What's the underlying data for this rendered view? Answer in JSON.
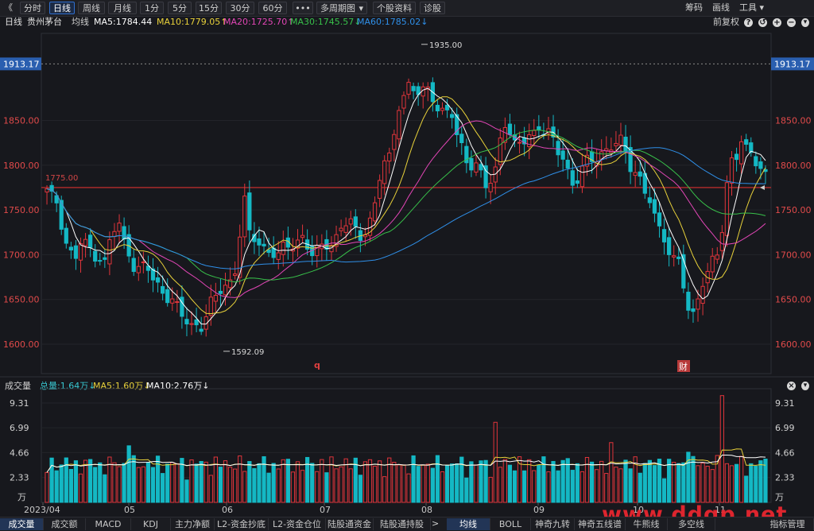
{
  "toolbar": {
    "back_icon": "double-chevron-left-icon",
    "back_glyph": "《",
    "periods": [
      "分时",
      "日线",
      "周线",
      "月线",
      "1分",
      "5分",
      "15分",
      "30分",
      "60分"
    ],
    "active_period": "日线",
    "more_glyph": "•••",
    "multi_period": "多周期图",
    "stock_info": "个股资料",
    "diagnose": "诊股",
    "chips": "筹码",
    "draw": "画线",
    "tools": "工具",
    "icons": [
      "help-icon",
      "add-icon",
      "remove-icon"
    ],
    "icon_glyphs": [
      "?",
      "+",
      "−"
    ]
  },
  "legend": {
    "period": "日线",
    "stock_name": "贵州茅台",
    "mean_line": "均线",
    "ma5": "MA5:1784.44",
    "ma10": "MA10:1779.05↑",
    "ma20": "MA20:1725.70↑",
    "ma30": "MA30:1745.57↓",
    "ma60": "MA60:1785.02↓",
    "adjust": "前复权",
    "colors": {
      "ma5": "#ffffff",
      "ma10": "#e8d13a",
      "ma20": "#e246b6",
      "ma30": "#38c04a",
      "ma60": "#2f8fe8"
    }
  },
  "volume_legend": {
    "label": "成交量",
    "total": "总量:1.64万↓",
    "ma5": "MA5:1.60万↓",
    "ma10": "MA10:2.76万↓"
  },
  "price_axis": {
    "ticks": [
      "1850.00",
      "1800.00",
      "1750.00",
      "1700.00",
      "1650.00",
      "1600.00"
    ],
    "current": "1913.17"
  },
  "volume_axis": {
    "ticks": [
      "9.31",
      "6.99",
      "4.66",
      "2.33"
    ],
    "unit": "万"
  },
  "annotations": {
    "high": "1935.00",
    "low": "1592.09",
    "hline": "1775.00",
    "marker_q": "q",
    "marker_cai": "财"
  },
  "chart_data": {
    "type": "candlestick",
    "title": "贵州茅台 日线",
    "x": [
      "2023/04",
      "05",
      "06",
      "07",
      "08",
      "09",
      "10",
      "11"
    ],
    "ylim": [
      1580,
      1950
    ],
    "yticks": [
      1600,
      1650,
      1700,
      1750,
      1800,
      1850
    ],
    "volume_ticks": [
      2.33,
      4.66,
      6.99,
      9.31
    ],
    "volume_unit": "万",
    "series": [
      {
        "name": "MA5",
        "last": 1784.44
      },
      {
        "name": "MA10",
        "last": 1779.05
      },
      {
        "name": "MA20",
        "last": 1725.7
      },
      {
        "name": "MA30",
        "last": 1745.57
      },
      {
        "name": "MA60",
        "last": 1785.02
      }
    ],
    "high": 1935.0,
    "low": 1592.09,
    "hline": 1775.0,
    "current": 1913.17
  },
  "bottom_tabs": [
    "成交量",
    "成交额",
    "MACD",
    "KDJ",
    "主力净额",
    "L2-资金抄底",
    "L2-资金仓位",
    "陆股通资金",
    "陆股通持股"
  ],
  "bottom_tabs_right": [
    "均线",
    "BOLL",
    "神奇九转",
    "神奇五线谱",
    "牛熊线",
    "多空线",
    "指标管理"
  ],
  "watermark": "www.ddgp.net"
}
